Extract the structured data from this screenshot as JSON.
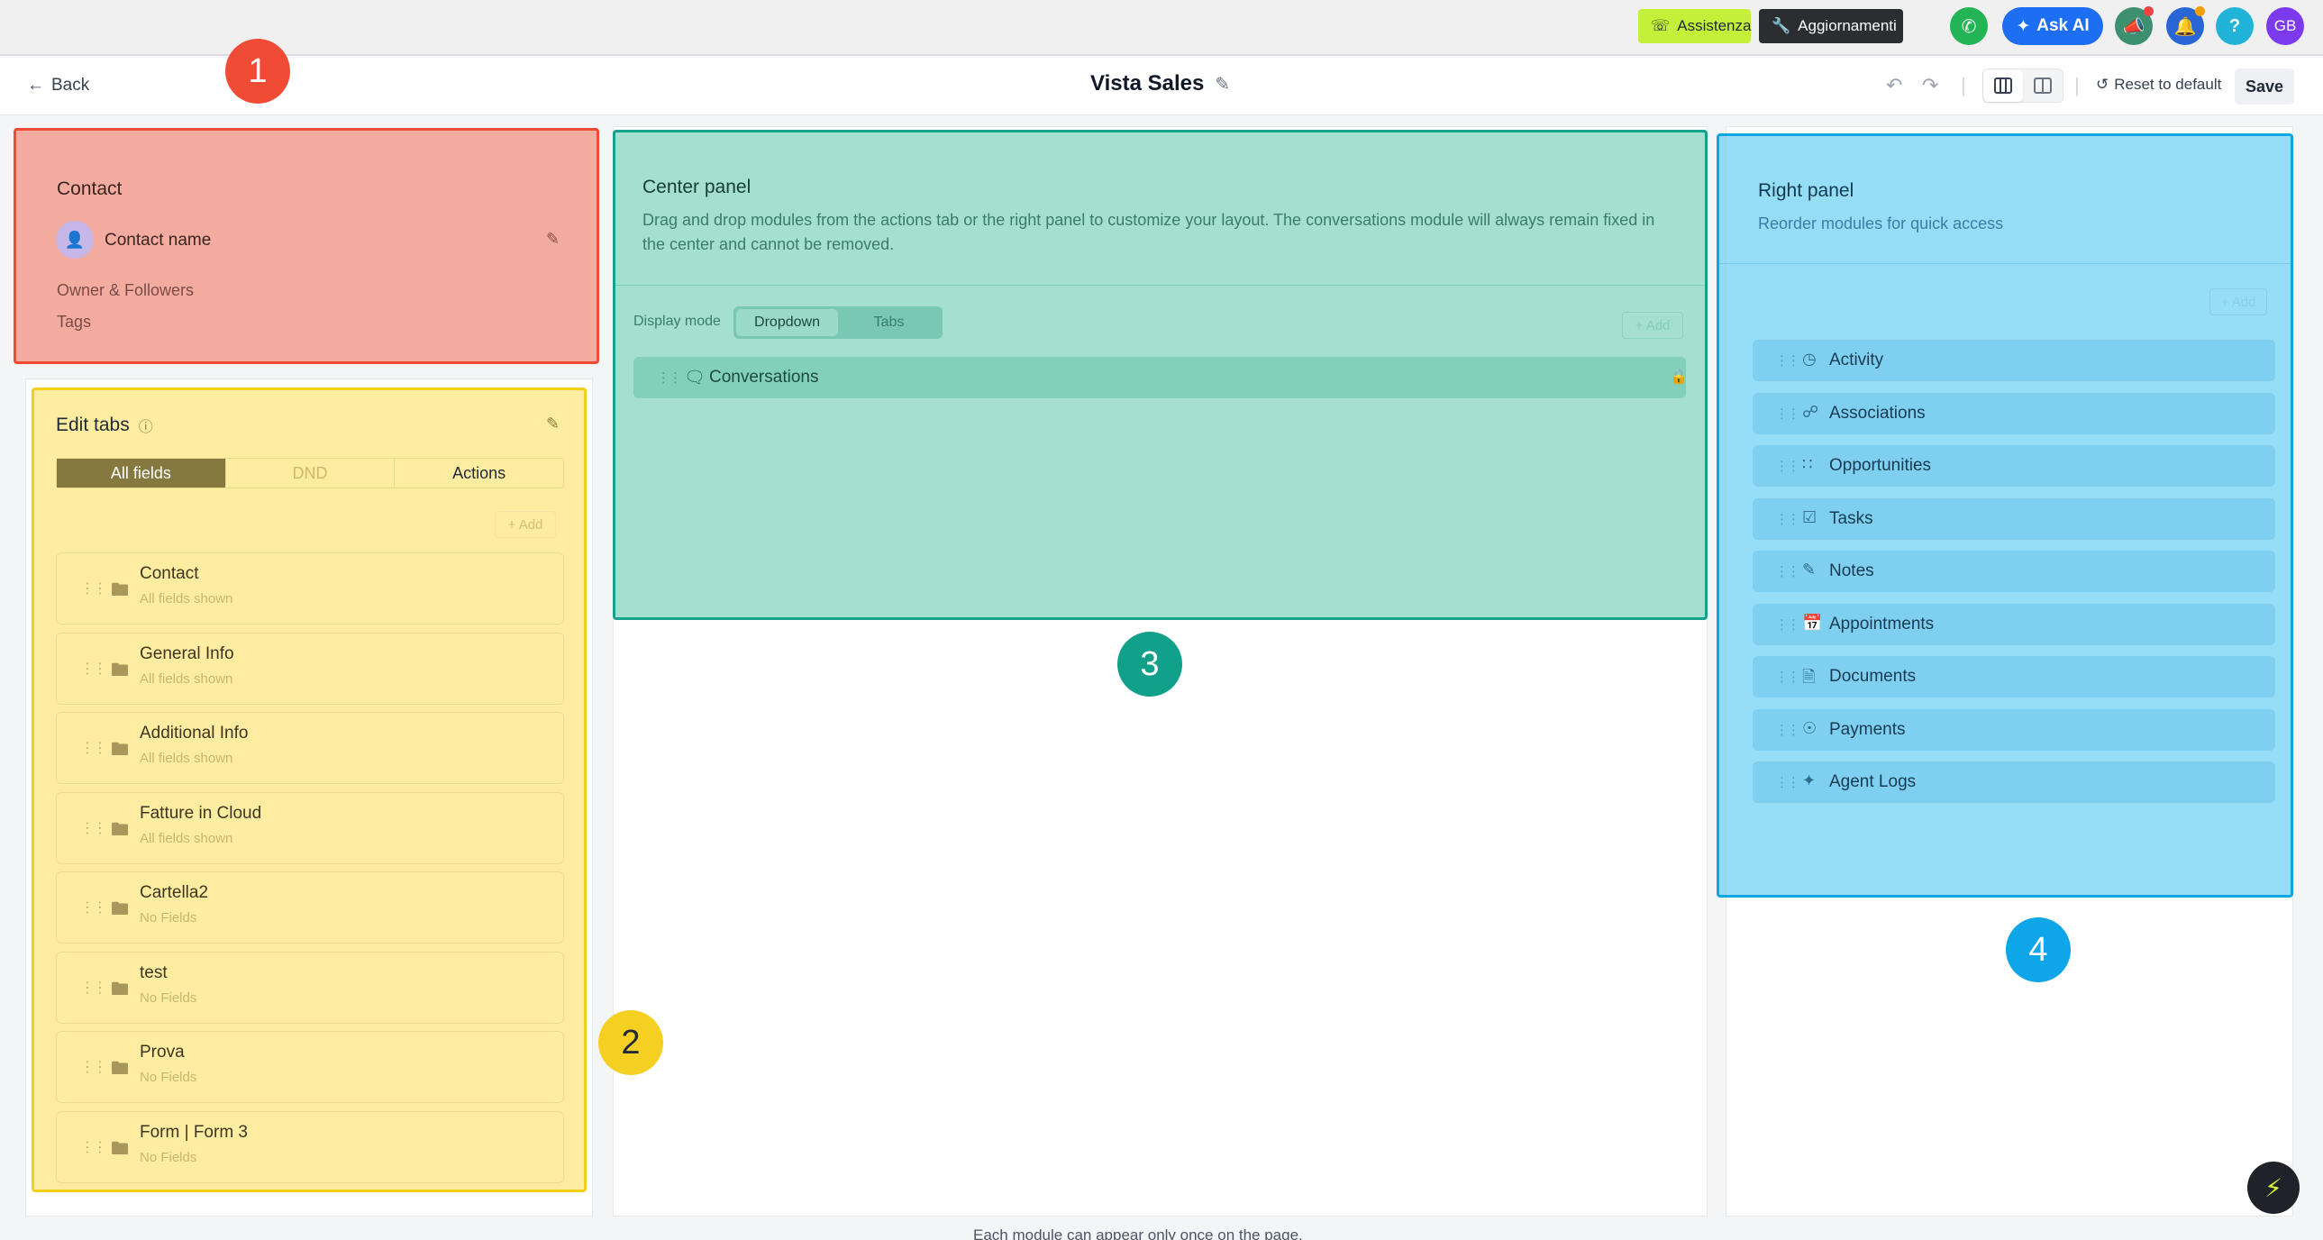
{
  "topbar": {
    "assistenza_label": "Assistenza",
    "aggiornamenti_label": "Aggiornamenti",
    "ask_ai_label": "Ask AI",
    "help_glyph": "?",
    "avatar_initials": "GB"
  },
  "header": {
    "back_label": "Back",
    "title": "Vista Sales",
    "reset_label": "Reset to default",
    "save_label": "Save"
  },
  "contact_panel": {
    "title": "Contact",
    "contact_name": "Contact name",
    "owner_followers": "Owner & Followers",
    "tags": "Tags"
  },
  "edit_tabs": {
    "title": "Edit tabs",
    "segments": [
      "All fields",
      "DND",
      "Actions"
    ],
    "add_label": "+ Add",
    "items": [
      {
        "name": "Contact",
        "sub": "All fields shown"
      },
      {
        "name": "General Info",
        "sub": "All fields shown"
      },
      {
        "name": "Additional Info",
        "sub": "All fields shown"
      },
      {
        "name": "Fatture in Cloud",
        "sub": "All fields shown"
      },
      {
        "name": "Cartella2",
        "sub": "No Fields"
      },
      {
        "name": "test",
        "sub": "No Fields"
      },
      {
        "name": "Prova",
        "sub": "No Fields"
      },
      {
        "name": "Form | Form 3",
        "sub": "No Fields"
      }
    ]
  },
  "center_panel": {
    "title": "Center panel",
    "description": "Drag and drop modules from the actions tab or the right panel to customize your layout. The conversations module will always remain fixed in the center and cannot be removed.",
    "display_mode_label": "Display mode",
    "modes": [
      "Dropdown",
      "Tabs"
    ],
    "add_label": "+ Add",
    "conversations_label": "Conversations"
  },
  "right_panel": {
    "title": "Right panel",
    "subtitle": "Reorder modules for quick access",
    "add_label": "+ Add",
    "modules": [
      {
        "name": "Activity",
        "icon": "clock-icon"
      },
      {
        "name": "Associations",
        "icon": "network-icon"
      },
      {
        "name": "Opportunities",
        "icon": "grid-icon"
      },
      {
        "name": "Tasks",
        "icon": "clipboard-icon"
      },
      {
        "name": "Notes",
        "icon": "pen-icon"
      },
      {
        "name": "Appointments",
        "icon": "calendar-icon"
      },
      {
        "name": "Documents",
        "icon": "document-icon"
      },
      {
        "name": "Payments",
        "icon": "dollar-icon"
      },
      {
        "name": "Agent Logs",
        "icon": "sparkle-icon"
      }
    ]
  },
  "badges": [
    "1",
    "2",
    "3",
    "4"
  ],
  "footer_note": "Each module can appear only once on the page.",
  "colors": {
    "panel1": "#ef4b35",
    "panel2": "#f4cf18",
    "panel3": "#14a08a",
    "panel4": "#10a6e4",
    "ask_ai": "#1d6ef2",
    "assistenza": "#c4f03a"
  }
}
